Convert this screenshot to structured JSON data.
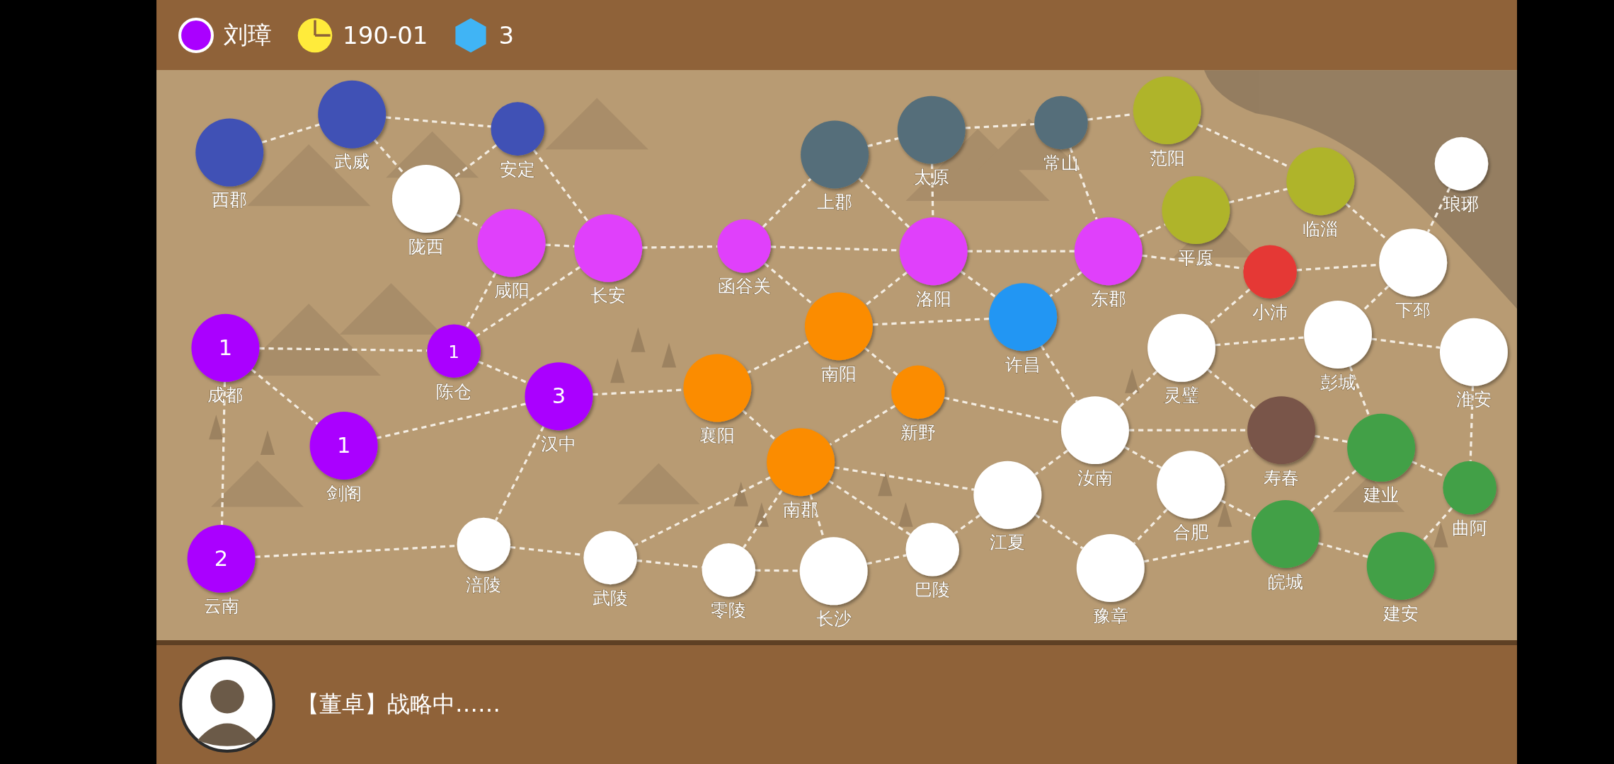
{
  "header": {
    "ruler": "刘璋",
    "date": "190-01",
    "resource": "3"
  },
  "cities": [
    {
      "name": "西郡",
      "color": "#3f51b5"
    },
    {
      "name": "武威",
      "color": "#3f51b5"
    },
    {
      "name": "安定",
      "color": "#3f51b5"
    },
    {
      "name": "上郡",
      "color": "#546e7a"
    },
    {
      "name": "太原",
      "color": "#546e7a"
    },
    {
      "name": "常山",
      "color": "#546e7a"
    },
    {
      "name": "范阳",
      "color": "#afb42b"
    },
    {
      "name": "琅琊",
      "color": "#ffffff"
    },
    {
      "name": "陇西",
      "color": "#ffffff"
    },
    {
      "name": "咸阳",
      "color": "#e040fb"
    },
    {
      "name": "长安",
      "color": "#e040fb"
    },
    {
      "name": "函谷关",
      "color": "#e040fb"
    },
    {
      "name": "洛阳",
      "color": "#e040fb"
    },
    {
      "name": "东郡",
      "color": "#e040fb"
    },
    {
      "name": "平原",
      "color": "#afb42b"
    },
    {
      "name": "小沛",
      "color": "#e53935"
    },
    {
      "name": "临淄",
      "color": "#afb42b"
    },
    {
      "name": "下邳",
      "color": "#ffffff"
    },
    {
      "name": "成都",
      "color": "#aa00ff",
      "troops": "1"
    },
    {
      "name": "陈仓",
      "color": "#aa00ff",
      "troops": "1"
    },
    {
      "name": "汉中",
      "color": "#aa00ff",
      "troops": "3"
    },
    {
      "name": "襄阳",
      "color": "#fb8c00"
    },
    {
      "name": "南阳",
      "color": "#fb8c00"
    },
    {
      "name": "新野",
      "color": "#fb8c00"
    },
    {
      "name": "许昌",
      "color": "#2196f3"
    },
    {
      "name": "灵璧",
      "color": "#ffffff"
    },
    {
      "name": "彭城",
      "color": "#ffffff"
    },
    {
      "name": "淮安",
      "color": "#ffffff"
    },
    {
      "name": "剑阁",
      "color": "#aa00ff",
      "troops": "1"
    },
    {
      "name": "南郡",
      "color": "#fb8c00"
    },
    {
      "name": "江夏",
      "color": "#ffffff"
    },
    {
      "name": "汝南",
      "color": "#ffffff"
    },
    {
      "name": "合肥",
      "color": "#ffffff"
    },
    {
      "name": "寿春",
      "color": "#795548"
    },
    {
      "name": "建业",
      "color": "#43a047"
    },
    {
      "name": "曲阿",
      "color": "#43a047"
    },
    {
      "name": "云南",
      "color": "#aa00ff",
      "troops": "2"
    },
    {
      "name": "涪陵",
      "color": "#ffffff"
    },
    {
      "name": "武陵",
      "color": "#ffffff"
    },
    {
      "name": "零陵",
      "color": "#ffffff"
    },
    {
      "name": "长沙",
      "color": "#ffffff"
    },
    {
      "name": "巴陵",
      "color": "#ffffff"
    },
    {
      "name": "豫章",
      "color": "#ffffff"
    },
    {
      "name": "皖城",
      "color": "#43a047"
    },
    {
      "name": "建安",
      "color": "#43a047"
    }
  ],
  "message": "【董卓】战略中……"
}
